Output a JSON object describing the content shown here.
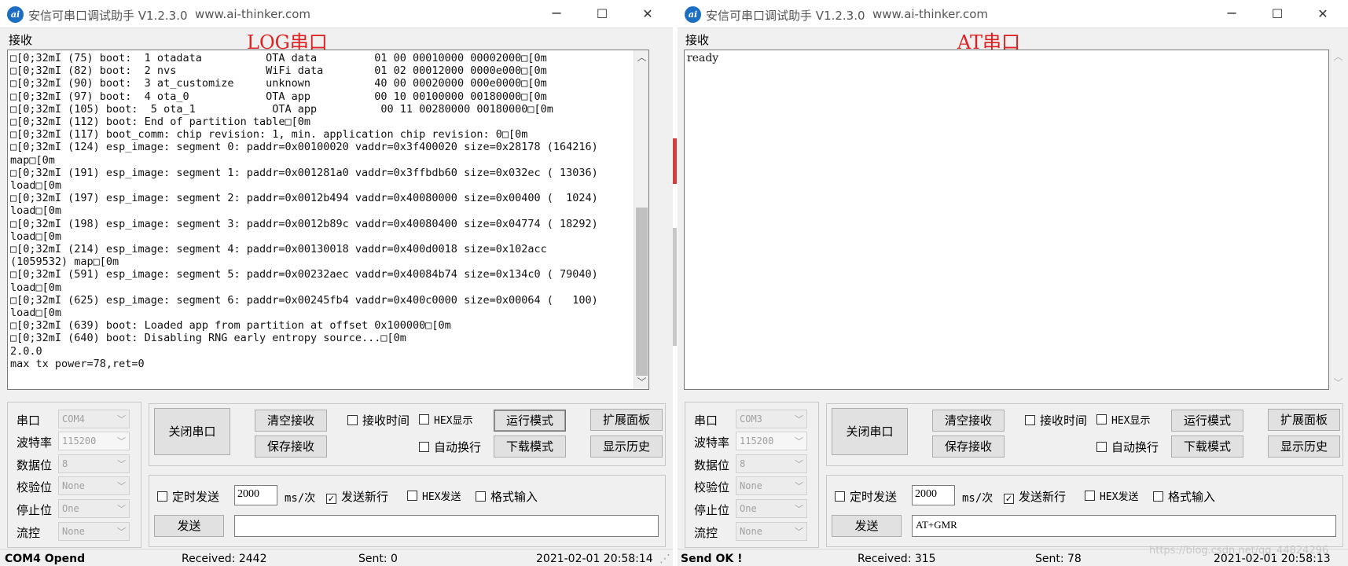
{
  "app": {
    "title": "安信可串口调试助手 V1.2.3.0",
    "url": "www.ai-thinker.com",
    "icon_text": "ai"
  },
  "labels": {
    "receive": "接收",
    "port": "串口",
    "baud": "波特率",
    "databits": "数据位",
    "parity": "校验位",
    "stopbits": "停止位",
    "flow": "流控",
    "close_port": "关闭串口",
    "clear_recv": "清空接收",
    "save_recv": "保存接收",
    "recv_time": "接收时间",
    "hex_display": "HEX显示",
    "auto_wrap": "自动换行",
    "run_mode": "运行模式",
    "download_mode": "下载模式",
    "expand_panel": "扩展面板",
    "show_history": "显示历史",
    "timed_send": "定时发送",
    "interval_unit": "ms/次",
    "send_newline": "发送新行",
    "hex_send": "HEX发送",
    "format_input": "格式输入",
    "send": "发送"
  },
  "left": {
    "tag": "LOG串口",
    "receive_text": "□[0;32mI (75) boot:  1 otadata          OTA data         01 00 00010000 00002000□[0m\n□[0;32mI (82) boot:  2 nvs              WiFi data        01 02 00012000 0000e000□[0m\n□[0;32mI (90) boot:  3 at_customize     unknown          40 00 00020000 000e0000□[0m\n□[0;32mI (97) boot:  4 ota_0            OTA app          00 10 00100000 00180000□[0m\n□[0;32mI (105) boot:  5 ota_1            OTA app          00 11 00280000 00180000□[0m\n□[0;32mI (112) boot: End of partition table□[0m\n□[0;32mI (117) boot_comm: chip revision: 1, min. application chip revision: 0□[0m\n□[0;32mI (124) esp_image: segment 0: paddr=0x00100020 vaddr=0x3f400020 size=0x28178 (164216)\nmap□[0m\n□[0;32mI (191) esp_image: segment 1: paddr=0x001281a0 vaddr=0x3ffbdb60 size=0x032ec ( 13036)\nload□[0m\n□[0;32mI (197) esp_image: segment 2: paddr=0x0012b494 vaddr=0x40080000 size=0x00400 (  1024)\nload□[0m\n□[0;32mI (198) esp_image: segment 3: paddr=0x0012b89c vaddr=0x40080400 size=0x04774 ( 18292)\nload□[0m\n□[0;32mI (214) esp_image: segment 4: paddr=0x00130018 vaddr=0x400d0018 size=0x102acc\n(1059532) map□[0m\n□[0;32mI (591) esp_image: segment 5: paddr=0x00232aec vaddr=0x40084b74 size=0x134c0 ( 79040)\nload□[0m\n□[0;32mI (625) esp_image: segment 6: paddr=0x00245fb4 vaddr=0x400c0000 size=0x00064 (   100)\nload□[0m\n□[0;32mI (639) boot: Loaded app from partition at offset 0x100000□[0m\n□[0;32mI (640) boot: Disabling RNG early entropy source...□[0m\n2.0.0\nmax tx power=78,ret=0",
    "port": "COM4",
    "baud": "115200",
    "databits": "8",
    "parity": "None",
    "stopbits": "One",
    "flow": "None",
    "interval": "2000",
    "send_text": "",
    "status": "COM4 Opend",
    "received": "Received: 2442",
    "sent": "Sent: 0",
    "datetime": "2021-02-01 20:58:14"
  },
  "right": {
    "tag": "AT串口",
    "receive_text": "ready",
    "port": "COM3",
    "baud": "115200",
    "databits": "8",
    "parity": "None",
    "stopbits": "One",
    "flow": "None",
    "interval": "2000",
    "send_text": "AT+GMR",
    "status": "Send OK !",
    "received": "Received: 315",
    "sent": "Sent: 78",
    "datetime": "2021-02-01 20:58:13"
  },
  "checks": {
    "timed_send": false,
    "send_newline": true,
    "hex_send": false,
    "format_input": false,
    "recv_time": false,
    "hex_display": false,
    "auto_wrap": false
  },
  "icons": {
    "minimize": "─",
    "maximize": "☐",
    "close": "✕",
    "dropdown": "﹀",
    "scroll_up": "︿",
    "scroll_down": "﹀",
    "check": "✓"
  },
  "watermark": "https://blog.csdn.net/qq_44824296"
}
